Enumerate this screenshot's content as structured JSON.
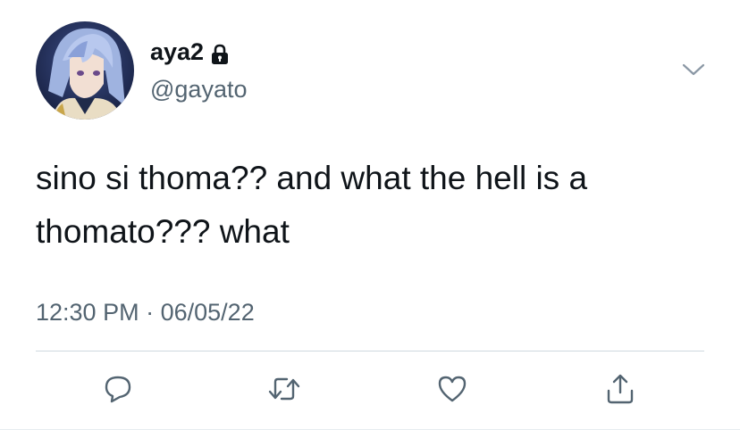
{
  "tweet": {
    "display_name": "aya2",
    "handle": "@gayato",
    "text": "sino si thoma?? and what the hell is a thomato??? what",
    "time": "12:30 PM",
    "separator": "·",
    "date": "06/05/22",
    "protected_icon": "lock-icon",
    "menu_icon": "chevron-down-icon"
  },
  "actions": [
    {
      "name": "reply",
      "icon": "speech-bubble-icon"
    },
    {
      "name": "retweet",
      "icon": "retweet-icon"
    },
    {
      "name": "like",
      "icon": "heart-icon"
    },
    {
      "name": "share",
      "icon": "share-icon"
    }
  ],
  "colors": {
    "primary_text": "#0f1419",
    "secondary_text": "#536471",
    "icon": "#536471",
    "divider": "#cfd9de"
  }
}
